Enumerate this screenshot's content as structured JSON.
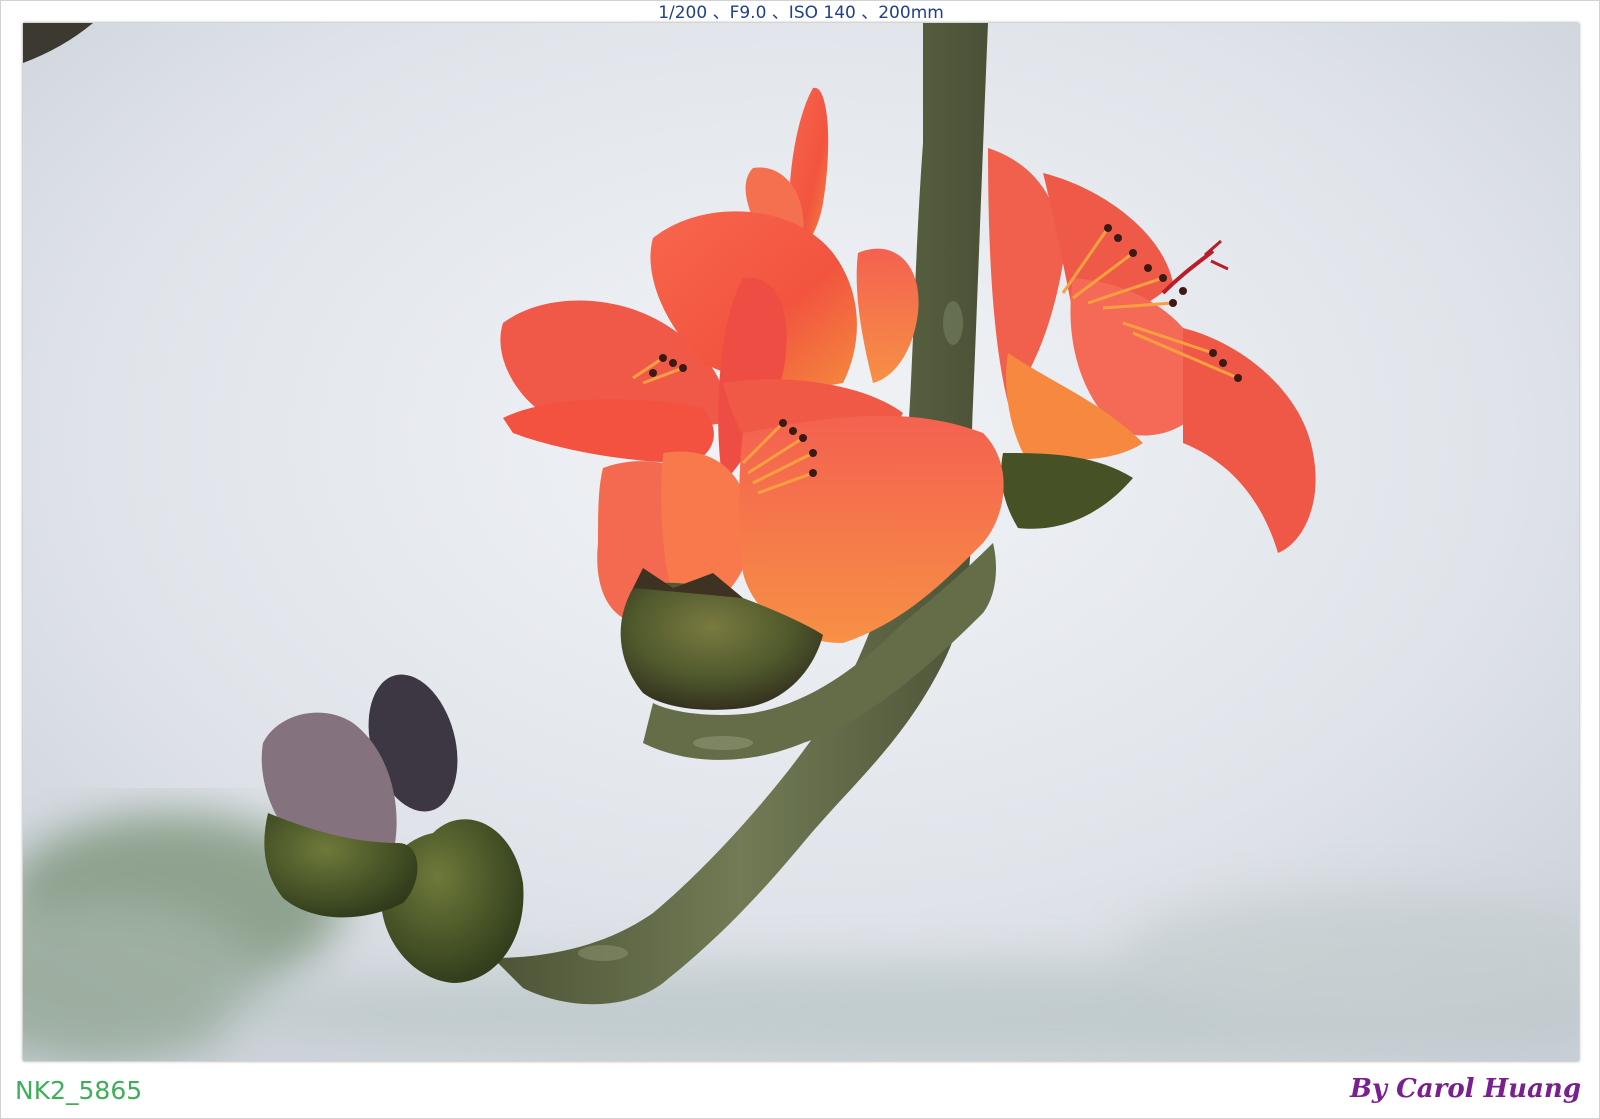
{
  "caption": {
    "exif": "1/200 、F9.0 、ISO 140 、200mm",
    "filename": "NK2_5865",
    "signature": "By Carol Huang"
  },
  "colors": {
    "exif_text": "#1f3f8f",
    "filename_text": "#3fae5a",
    "signature_text": "#7a1f8f",
    "sky": "#dfe3e9",
    "petal": "#f2543f",
    "branch": "#5f6a45"
  }
}
